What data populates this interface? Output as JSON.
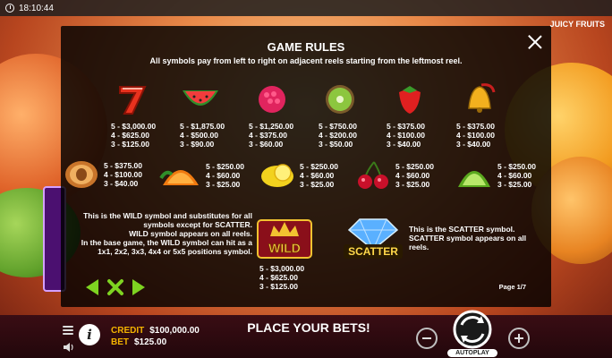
{
  "status_bar": {
    "time": "18:10:44",
    "game_name": "JUICY FRUITS"
  },
  "modal": {
    "title": "GAME RULES",
    "subtitle": "All symbols pay from left to right on adjacent reels starting from the leftmost reel.",
    "close_icon": "close-icon",
    "symbols_row1": [
      {
        "icon": "seven-icon",
        "pays": [
          "5 - $3,000.00",
          "4 - $625.00",
          "3 - $125.00"
        ]
      },
      {
        "icon": "watermelon-icon",
        "pays": [
          "5 - $1,875.00",
          "4 - $500.00",
          "3 - $90.00"
        ]
      },
      {
        "icon": "raspberry-icon",
        "pays": [
          "5 - $1,250.00",
          "4 - $375.00",
          "3 - $60.00"
        ]
      },
      {
        "icon": "kiwi-icon",
        "pays": [
          "5 - $750.00",
          "4 - $200.00",
          "3 - $50.00"
        ]
      },
      {
        "icon": "strawberry-icon",
        "pays": [
          "5 - $375.00",
          "4 - $100.00",
          "3 - $40.00"
        ]
      },
      {
        "icon": "bell-icon",
        "pays": [
          "5 - $375.00",
          "4 - $100.00",
          "3 - $40.00"
        ]
      }
    ],
    "symbols_row2": [
      {
        "icon": "plum-icon",
        "pays": [
          "5 - $375.00",
          "4 - $100.00",
          "3 - $40.00"
        ]
      },
      {
        "icon": "orange-icon",
        "pays": [
          "5 - $250.00",
          "4 - $60.00",
          "3 - $25.00"
        ]
      },
      {
        "icon": "lemon-icon",
        "pays": [
          "5 - $250.00",
          "4 - $60.00",
          "3 - $25.00"
        ]
      },
      {
        "icon": "cherry-icon",
        "pays": [
          "5 - $250.00",
          "4 - $60.00",
          "3 - $25.00"
        ]
      },
      {
        "icon": "lime-icon",
        "pays": [
          "5 - $250.00",
          "4 - $60.00",
          "3 - $25.00"
        ]
      }
    ],
    "wild": {
      "badge_text": "WILD",
      "description": [
        "This is the WILD symbol and substitutes for all symbols except for SCATTER.",
        "WILD symbol appears on all reels.",
        "In the base game, the WILD symbol can hit as a 1x1, 2x2, 3x3, 4x4 or 5x5 positions symbol."
      ],
      "pays": [
        "5 - $3,000.00",
        "4 - $625.00",
        "3 - $125.00"
      ]
    },
    "scatter": {
      "badge_text": "SCATTER",
      "description": "This is the SCATTER symbol. SCATTER symbol appears on all reels."
    },
    "navigation": {
      "prev_icon": "arrow-left-icon",
      "close_rules_icon": "x-icon",
      "next_icon": "arrow-right-icon"
    },
    "page_indicator": "Page 1/7"
  },
  "bottom_bar": {
    "credit_label": "CREDIT",
    "credit_value": "$100,000.00",
    "bet_label": "BET",
    "bet_value": "$125.00",
    "message": "PLACE YOUR BETS!",
    "autoplay_label": "AUTOPLAY"
  },
  "colors": {
    "accent_yellow": "#f4b400",
    "nav_green": "#7ed321",
    "modal_bg": "#000000"
  }
}
